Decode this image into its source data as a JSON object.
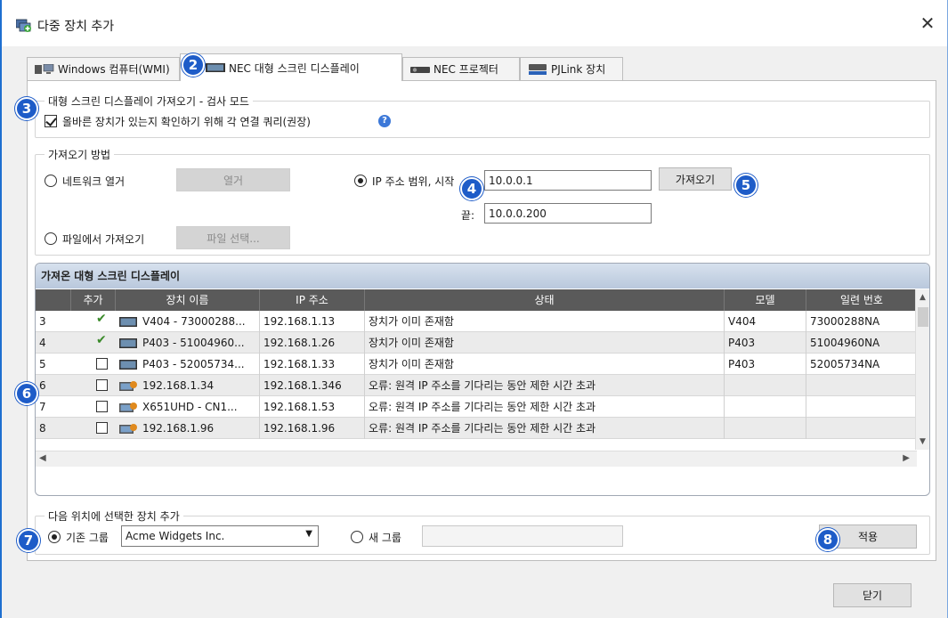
{
  "window": {
    "title": "다중 장치 추가",
    "close": "✕"
  },
  "tabs": [
    {
      "label": "Windows 컴퓨터(WMI)"
    },
    {
      "label": "NEC 대형 스크린 디스플레이"
    },
    {
      "label": "NEC 프로젝터"
    },
    {
      "label": "PJLink 장치"
    }
  ],
  "scan_mode": {
    "legend": "대형 스크린 디스플레이 가져오기 - 검사 모드",
    "checkbox_label": "올바른 장치가 있는지 확인하기 위해 각 연결 쿼리(권장)",
    "checked": true
  },
  "import_method": {
    "legend": "가져오기 방법",
    "network_label": "네트워크 열거",
    "network_button": "열거",
    "file_label": "파일에서 가져오기",
    "file_button": "파일 선택...",
    "ip_range_label": "IP 주소 범위, 시작",
    "ip_start": "10.0.0.1",
    "ip_end_label": "끝:",
    "ip_end": "10.0.0.200",
    "import_button": "가져오기"
  },
  "grid": {
    "title": "가져온 대형 스크린 디스플레이",
    "columns": [
      "추가",
      "장치 이름",
      "IP 주소",
      "상태",
      "모델",
      "일련 번호"
    ],
    "rows": [
      {
        "num": "3",
        "checked": true,
        "name": "V404 - 73000288...",
        "ip": "192.168.1.13",
        "status": "장치가 이미 존재함",
        "model": "V404",
        "serial": "73000288NA"
      },
      {
        "num": "4",
        "checked": true,
        "name": "P403 - 51004960...",
        "ip": "192.168.1.26",
        "status": "장치가 이미 존재함",
        "model": "P403",
        "serial": "51004960NA"
      },
      {
        "num": "5",
        "checked": false,
        "name": "P403 - 52005734...",
        "ip": "192.168.1.33",
        "status": "장치가 이미 존재함",
        "model": "P403",
        "serial": "52005734NA"
      },
      {
        "num": "6",
        "checked": false,
        "name": "192.168.1.34",
        "ip": "192.168.1.346",
        "status": "오류: 원격 IP 주소를 기다리는 동안 제한 시간 초과",
        "model": "",
        "serial": ""
      },
      {
        "num": "7",
        "checked": false,
        "name": "X651UHD - CN1...",
        "ip": "192.168.1.53",
        "status": "오류: 원격 IP 주소를 기다리는 동안 제한 시간 초과",
        "model": "",
        "serial": ""
      },
      {
        "num": "8",
        "checked": false,
        "name": "192.168.1.96",
        "ip": "192.168.1.96",
        "status": "오류: 원격 IP 주소를 기다리는 동안 제한 시간 초과",
        "model": "",
        "serial": ""
      }
    ]
  },
  "add_to": {
    "legend": "다음 위치에 선택한 장치 추가",
    "existing_label": "기존 그룹",
    "existing_value": "Acme Widgets Inc.",
    "new_label": "새 그룹",
    "apply_button": "적용"
  },
  "footer": {
    "close_button": "닫기"
  },
  "badges": [
    "2",
    "3",
    "4",
    "5",
    "6",
    "7",
    "8"
  ]
}
